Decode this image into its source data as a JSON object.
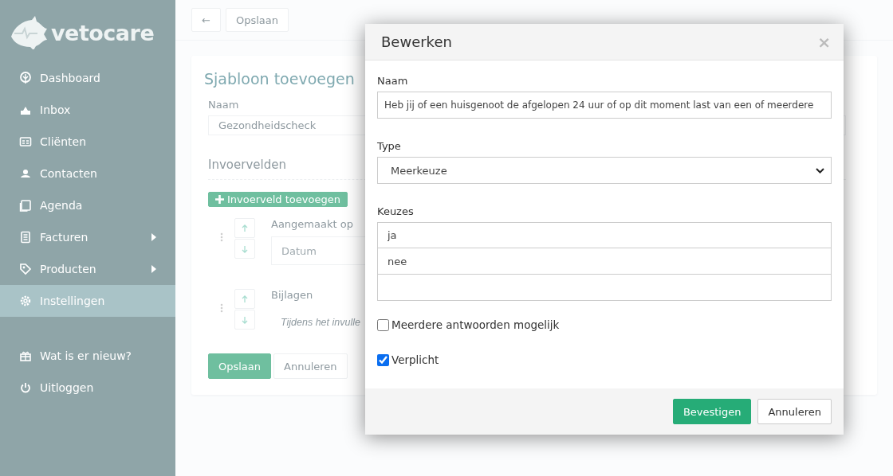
{
  "sidebar": {
    "logo": "vetocare",
    "items": [
      {
        "label": "Dashboard",
        "submenu": false,
        "selected": false
      },
      {
        "label": "Inbox",
        "submenu": false,
        "selected": false
      },
      {
        "label": "Cliënten",
        "submenu": false,
        "selected": false
      },
      {
        "label": "Contacten",
        "submenu": false,
        "selected": false
      },
      {
        "label": "Agenda",
        "submenu": false,
        "selected": false
      },
      {
        "label": "Facturen",
        "submenu": true,
        "selected": false
      },
      {
        "label": "Producten",
        "submenu": true,
        "selected": false
      },
      {
        "label": "Instellingen",
        "submenu": false,
        "selected": true
      }
    ],
    "bottom_items": [
      {
        "label": "Wat is er nieuw?"
      },
      {
        "label": "Uitloggen"
      }
    ]
  },
  "toolbar": {
    "back": "←",
    "save": "Opslaan"
  },
  "card": {
    "title": "Sjabloon toevoegen",
    "name_label": "Naam",
    "name_value": "Gezondheidscheck",
    "section": "Invoervelden",
    "add_button": "Invoerveld toevoegen",
    "fields": [
      {
        "label": "Aangemaakt op",
        "placeholder": "Datum",
        "kind": "input"
      },
      {
        "label": "Bijlagen",
        "hint": "Tijdens het invulle",
        "kind": "hint"
      }
    ],
    "save": "Opslaan",
    "cancel": "Annuleren"
  },
  "dialog": {
    "title": "Bewerken",
    "close": "×",
    "name_label": "Naam",
    "name_value": "Heb jij of een huisgenoot de afgelopen 24 uur of op dit moment last van een of meerdere",
    "type_label": "Type",
    "type_value": "Meerkeuze",
    "choices_label": "Keuzes",
    "choices": [
      "ja",
      "nee"
    ],
    "options": [
      {
        "label": "Meerdere antwoorden mogelijk",
        "checked": false
      },
      {
        "label": "Verplicht",
        "checked": true
      }
    ],
    "confirm": "Bevestigen",
    "cancel": "Annuleren"
  }
}
